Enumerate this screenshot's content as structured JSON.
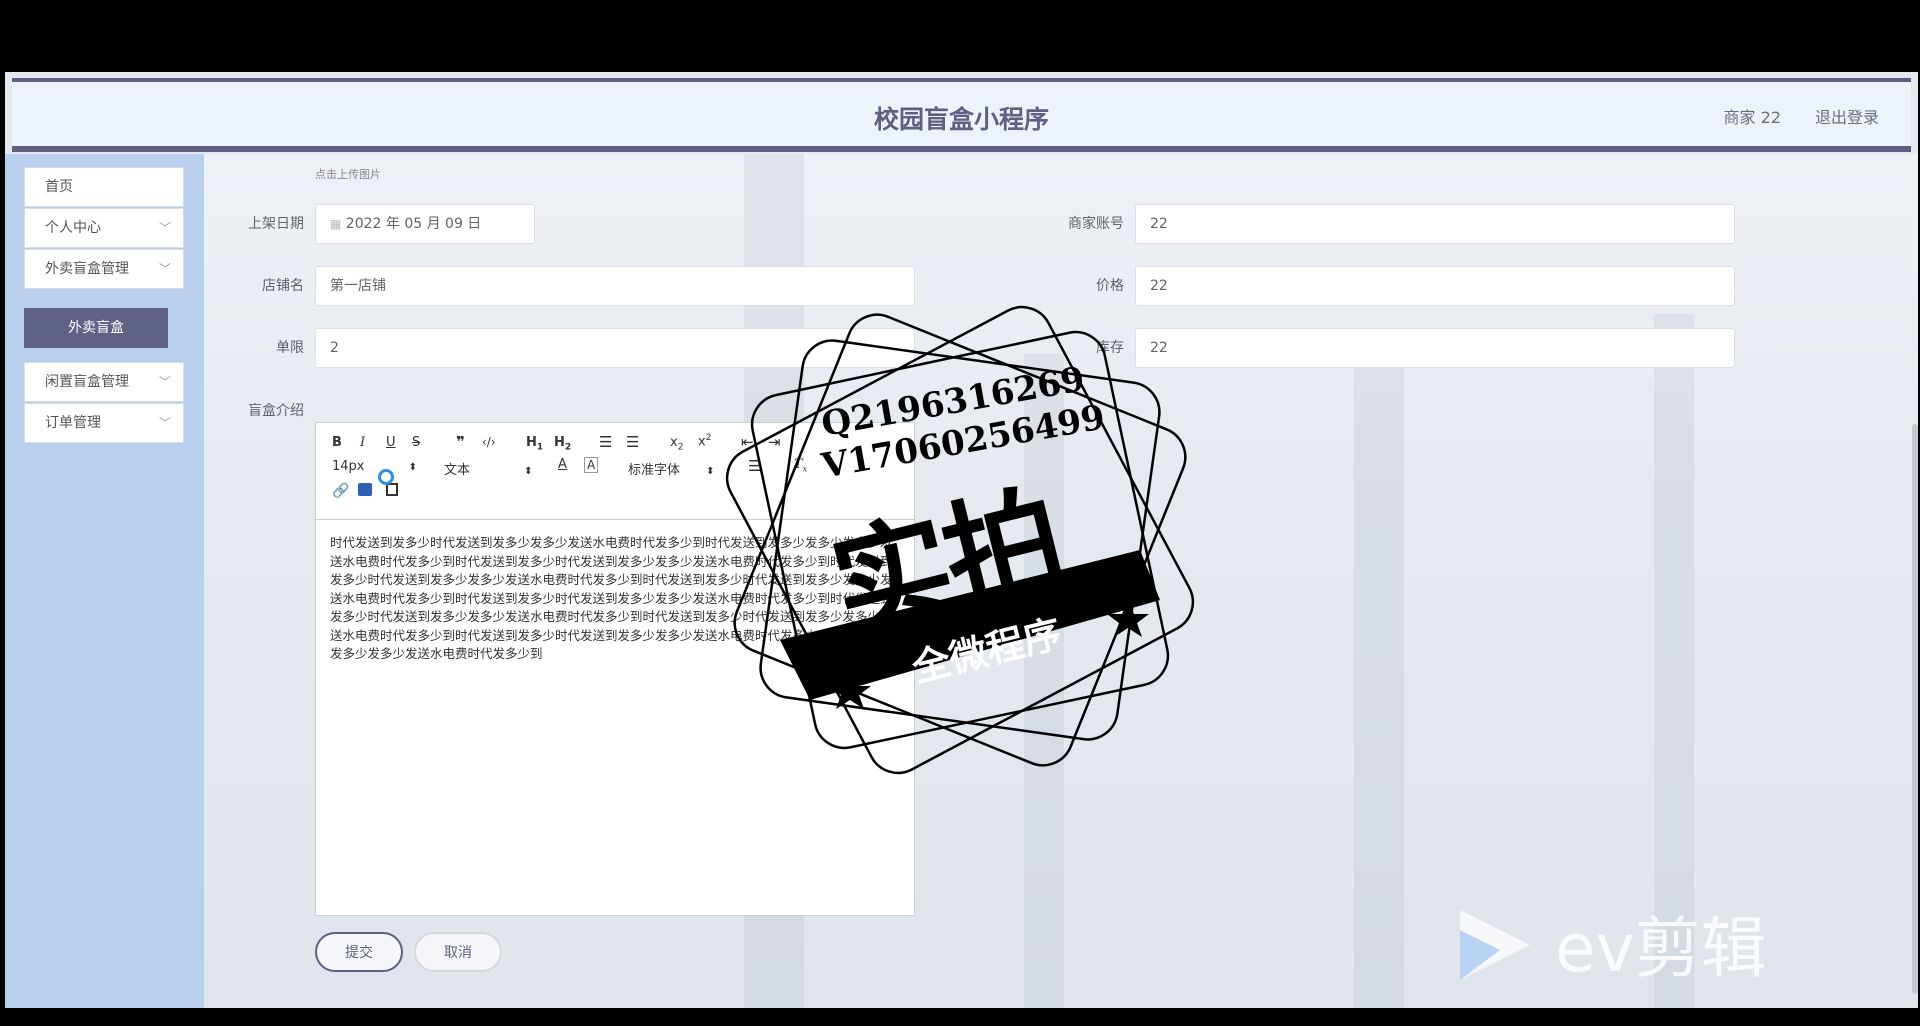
{
  "header": {
    "title": "校园盲盒小程序",
    "user": "商家 22",
    "logout": "退出登录"
  },
  "sidebar": {
    "items": [
      {
        "label": "首页"
      },
      {
        "label": "个人中心"
      },
      {
        "label": "外卖盲盒管理"
      },
      {
        "label": "闲置盲盒管理"
      },
      {
        "label": "订单管理"
      }
    ],
    "submenu_active": "外卖盲盒"
  },
  "form": {
    "upload_hint": "点击上传图片",
    "date_label": "上架日期",
    "date_value": "2022 年 05 月 09 日",
    "account_label": "商家账号",
    "account_value": "22",
    "shop_label": "店铺名",
    "shop_value": "第一店铺",
    "price_label": "价格",
    "price_value": "22",
    "limit_label": "单限",
    "limit_value": "2",
    "stock_label": "库存",
    "stock_value": "22",
    "intro_label": "盲盒介绍"
  },
  "editor": {
    "font_size": "14px",
    "text_type": "文本",
    "font_family": "标准字体",
    "content": "时代发送到发多少时代发送到发多少发多少发送水电费时代发多少到时代发送到发多少发多少发多少发送水电费时代发多少到时代发送到发多少时代发送到发多少发多少发送水电费时代发多少到时代发送到发多少时代发送到发多少发多少发送水电费时代发多少到时代发送到发多少时代发送到发多少发多少发送水电费时代发多少到时代发送到发多少时代发送到发多少发多少发送水电费时代发多少到时代发送到发多少时代发送到发多少发多少发送水电费时代发多少到时代发送到发多少时代发送到发多少发多少发送水电费时代发多少到时代发送到发多少时代发送到发多少发多少发送水电费时代发多少到时代发送到发多少发多少发送水电费时代发多少到"
  },
  "buttons": {
    "submit": "提交",
    "cancel": "取消"
  },
  "watermark": {
    "line1": "Q2196316269",
    "line2": "V17060256499",
    "big": "实拍",
    "banner": "全微程序",
    "ev": "ev剪辑"
  }
}
